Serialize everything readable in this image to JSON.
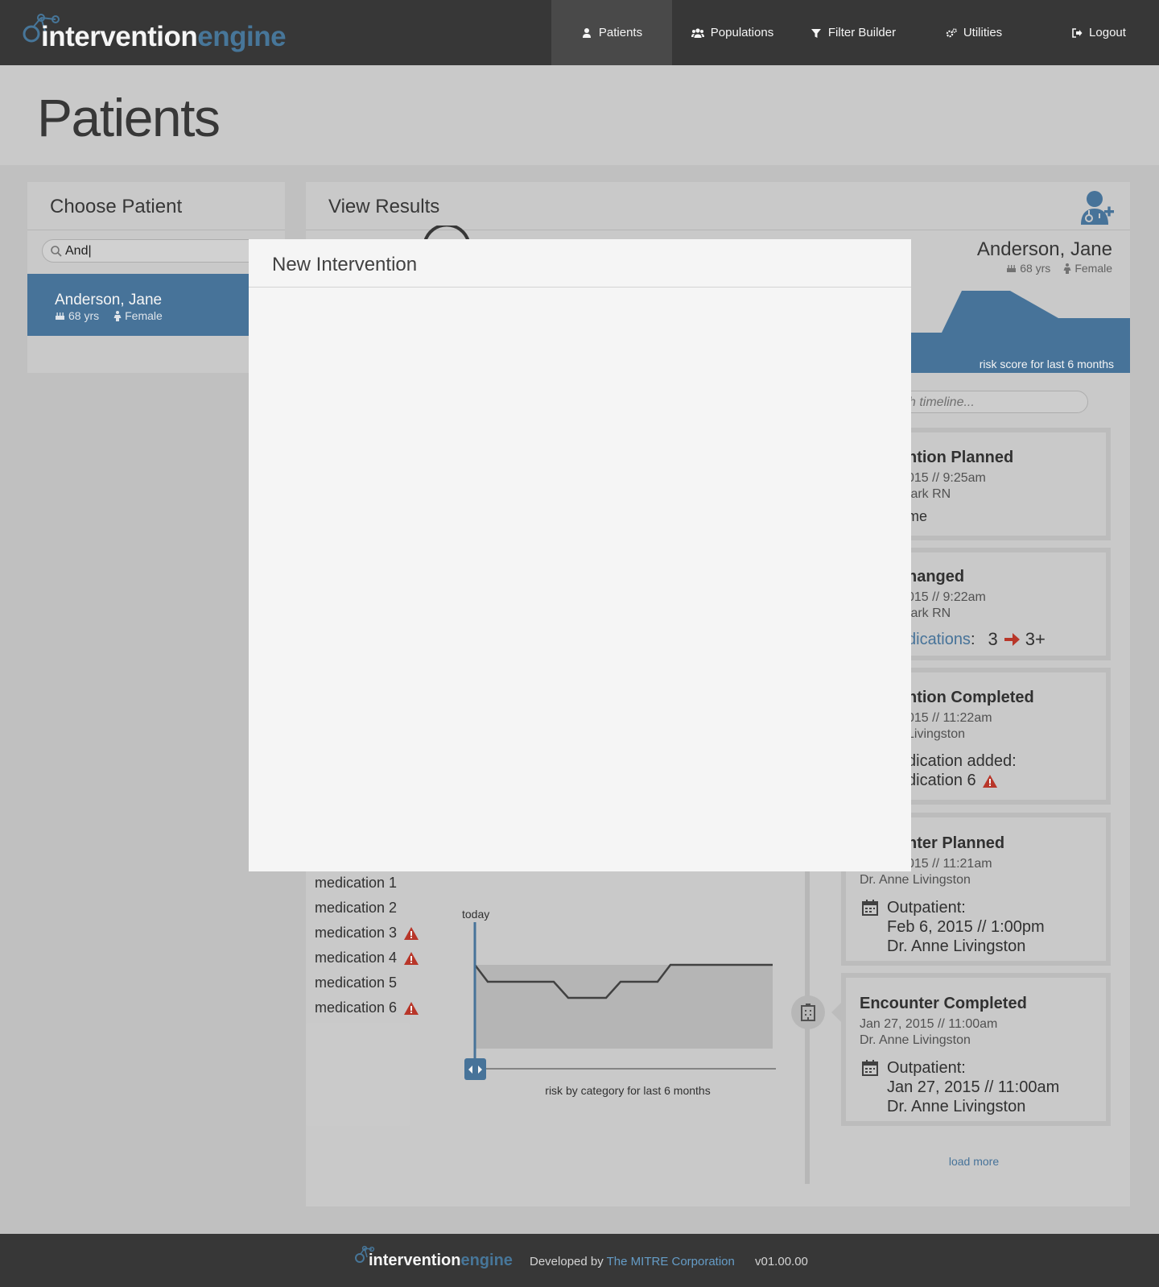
{
  "app": {
    "logo_text_main": "intervention",
    "logo_text_accent": "engine"
  },
  "nav": {
    "items": [
      {
        "label": "Patients",
        "icon": "user-icon",
        "active": true
      },
      {
        "label": "Populations",
        "icon": "users-icon"
      },
      {
        "label": "Filter Builder",
        "icon": "filter-icon"
      },
      {
        "label": "Utilities",
        "icon": "gears-icon"
      },
      {
        "label": "Logout",
        "icon": "sign-out-icon"
      }
    ]
  },
  "page": {
    "title": "Patients"
  },
  "choose_patient": {
    "title": "Choose Patient",
    "search_value": "And|",
    "patients": [
      {
        "name": "Anderson, Jane",
        "age": "68 yrs",
        "gender": "Female"
      }
    ]
  },
  "view_results": {
    "title": "View Results",
    "patient_name": "Anderson, Jane",
    "age": "68 yrs",
    "gender": "Female",
    "risk_chart_caption": "risk score for last 6 months",
    "timeline_search_placeholder": "ch timeline...",
    "medications": [
      {
        "label": "medication 1",
        "warning": false
      },
      {
        "label": "medication 2",
        "warning": false
      },
      {
        "label": "medication 3",
        "warning": true
      },
      {
        "label": "medication 4",
        "warning": true
      },
      {
        "label": "medication 5",
        "warning": false
      },
      {
        "label": "medication 6",
        "warning": true
      }
    ],
    "category_chart": {
      "today_label": "today",
      "caption": "risk by category for last 6 months"
    },
    "timeline": [
      {
        "title": "ntion Planned",
        "date": "015  //  9:25am",
        "author": "tark RN",
        "detail": "me"
      },
      {
        "title": "nanged",
        "date": "015  //  9:22am",
        "author": "tark RN",
        "detail_link": "dications",
        "detail_colon": ":",
        "from": "3",
        "to": "3+"
      },
      {
        "title": "ntion Completed",
        "date": "015  //  11:22am",
        "author": "Livingston",
        "detail_line1": "dication added:",
        "detail_line2": "dication 6"
      },
      {
        "title": "nter Planned",
        "date": "015  //  11:21am",
        "author": "Dr. Anne Livingston",
        "type": "Outpatient:",
        "when": "Feb 6, 2015 // 1:00pm",
        "provider": "Dr. Anne Livingston"
      },
      {
        "title": "Encounter Completed",
        "date": "Jan 27, 2015  //  11:00am",
        "author": "Dr. Anne Livingston",
        "type": "Outpatient:",
        "when": "Jan 27, 2015 // 11:00am",
        "provider": "Dr. Anne Livingston"
      }
    ],
    "load_more": "load more"
  },
  "modal": {
    "title": "New Intervention"
  },
  "footer": {
    "logo_text_main": "intervention",
    "logo_text_accent": "engine",
    "developed_by": "Developed by",
    "org": "The MITRE Corporation",
    "version": "v01.00.00"
  },
  "colors": {
    "accent": "#4a78a0",
    "nav_bg": "#3a3a3a",
    "warning": "#c0392b"
  }
}
